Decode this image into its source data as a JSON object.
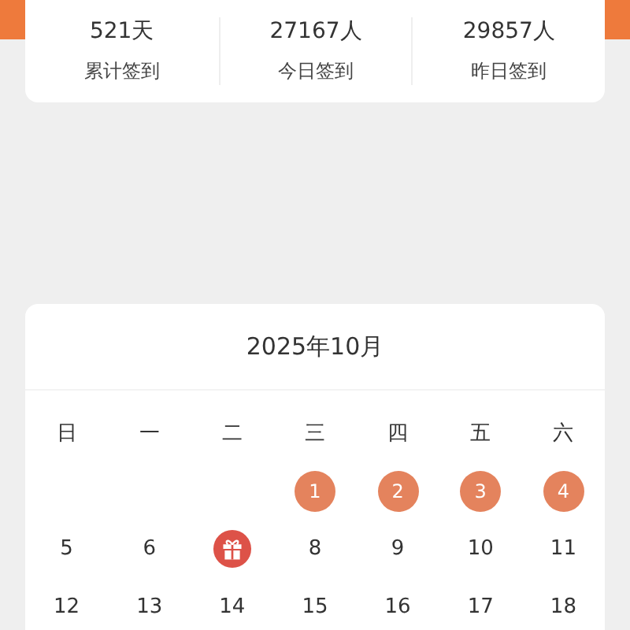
{
  "stats": [
    {
      "value": "521天",
      "label": "累计签到"
    },
    {
      "value": "27167人",
      "label": "今日签到"
    },
    {
      "value": "29857人",
      "label": "昨日签到"
    }
  ],
  "calendar": {
    "title": "2025年10月",
    "weekdays": [
      "日",
      "一",
      "二",
      "三",
      "四",
      "五",
      "六"
    ],
    "days": [
      {
        "kind": "blank"
      },
      {
        "kind": "blank"
      },
      {
        "kind": "blank"
      },
      {
        "kind": "day",
        "label": "1",
        "signed": true
      },
      {
        "kind": "day",
        "label": "2",
        "signed": true
      },
      {
        "kind": "day",
        "label": "3",
        "signed": true
      },
      {
        "kind": "day",
        "label": "4",
        "signed": true
      },
      {
        "kind": "day",
        "label": "5",
        "signed": false
      },
      {
        "kind": "day",
        "label": "6",
        "signed": false
      },
      {
        "kind": "gift"
      },
      {
        "kind": "day",
        "label": "8",
        "signed": false
      },
      {
        "kind": "day",
        "label": "9",
        "signed": false
      },
      {
        "kind": "day",
        "label": "10",
        "signed": false
      },
      {
        "kind": "day",
        "label": "11",
        "signed": false
      },
      {
        "kind": "day",
        "label": "12",
        "signed": false
      },
      {
        "kind": "day",
        "label": "13",
        "signed": false
      },
      {
        "kind": "day",
        "label": "14",
        "signed": false
      },
      {
        "kind": "day",
        "label": "15",
        "signed": false
      },
      {
        "kind": "day",
        "label": "16",
        "signed": false
      },
      {
        "kind": "day",
        "label": "17",
        "signed": false
      },
      {
        "kind": "day",
        "label": "18",
        "signed": false
      }
    ]
  }
}
